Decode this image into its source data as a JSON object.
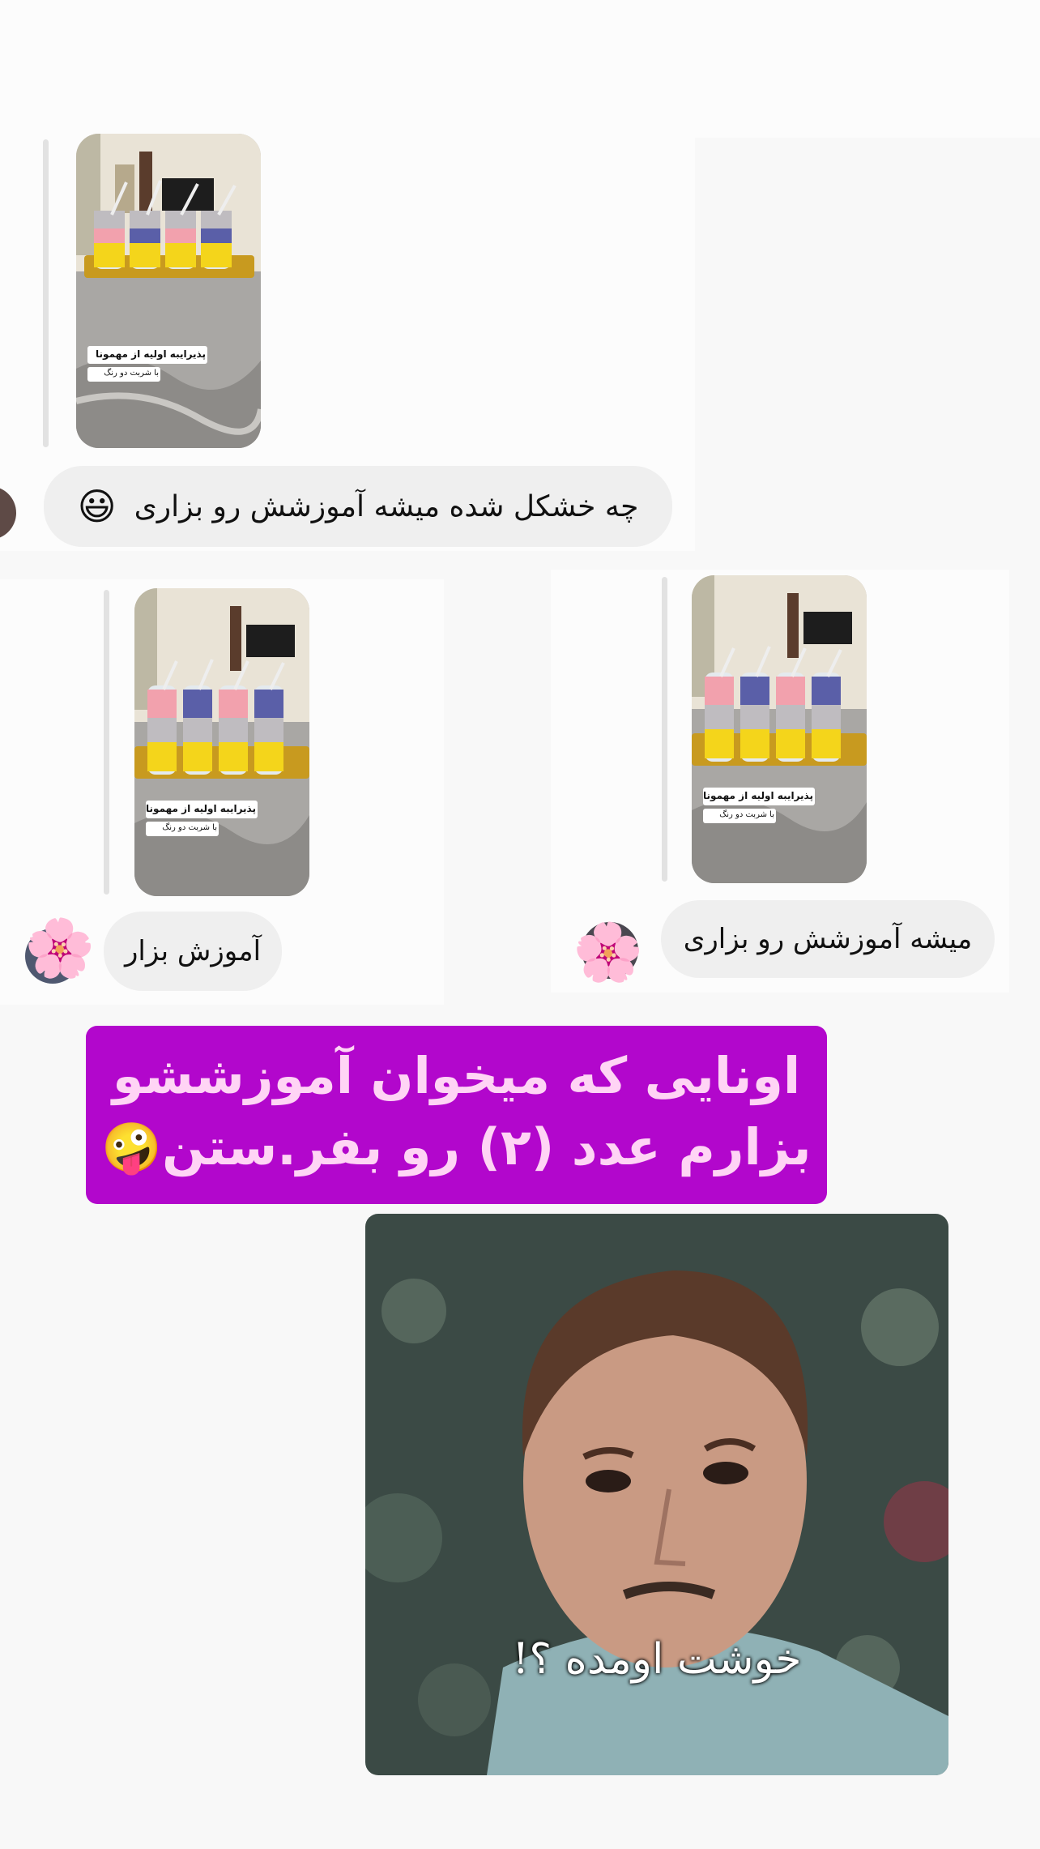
{
  "colors": {
    "page_bg": "#f8f8f8",
    "bubble_bg": "#efefef",
    "banner_bg": "#b207cc",
    "banner_text": "#ffd4f5"
  },
  "thread": {
    "top_message": {
      "story_caption_line1": "پذیرایبه اولیه از مهمونا",
      "story_caption_line2": "با شربت دو رنگ",
      "text": "چه خشکل شده میشه آموزشش رو بزاری",
      "emoji": "😃"
    },
    "left_message": {
      "story_caption_line1": "پذیرایبه اولیه از مهمونا",
      "story_caption_line2": "با شربت دو رنگ",
      "text": "آموزش بزار",
      "avatar_emoji": "🌸"
    },
    "right_message": {
      "story_caption_line1": "پذیرایبه اولیه از مهمونا",
      "story_caption_line2": "با شربت دو رنگ",
      "text": "میشه آموزشش رو بزاری",
      "avatar_emoji": "🌸"
    }
  },
  "banner": {
    "line1": "اونایی که میخوان آموزششو",
    "line2": "بزارم عدد (۲) رو بفر.ستن",
    "emoji": "🤪"
  },
  "meme": {
    "caption": "خوشت اومده ؟!"
  }
}
